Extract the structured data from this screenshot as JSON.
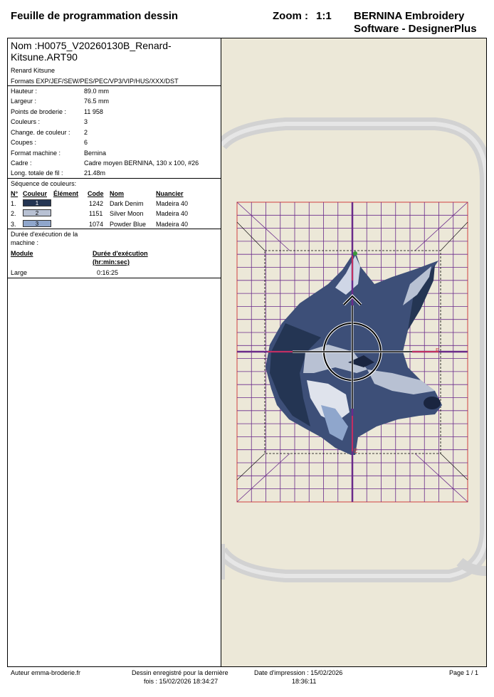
{
  "header": {
    "title": "Feuille de programmation dessin",
    "zoom_label": "Zoom :",
    "zoom_value": "1:1",
    "brand_line1": "BERNINA Embroidery",
    "brand_line2": "Software - DesignerPlus"
  },
  "design": {
    "name_line1": "Nom :H0075_V20260130B_Renard-",
    "name_line2": "Kitsune.ART90",
    "description": "Renard Kitsune",
    "formats": "Formats EXP/JEF/SEW/PES/PEC/VP3/VIP/HUS/XXX/DST"
  },
  "specs": [
    {
      "label": "Hauteur :",
      "value": "89.0 mm"
    },
    {
      "label": "Largeur :",
      "value": "76.5 mm"
    },
    {
      "label": "Points de broderie :",
      "value": "11 958"
    },
    {
      "label": "Couleurs :",
      "value": "3"
    },
    {
      "label": "Change. de couleur :",
      "value": "2"
    },
    {
      "label": "Coupes :",
      "value": "6"
    },
    {
      "label": "Format machine :",
      "value": "Bernina"
    },
    {
      "label": "Cadre :",
      "value": "Cadre moyen BERNINA, 130 x 100, #26"
    },
    {
      "label": "Long. totale de fil :",
      "value": "21.48m"
    }
  ],
  "colors": {
    "section_title": "Séquence de couleurs:",
    "headers": {
      "num": "N°",
      "color": "Couleur",
      "element": "Élément",
      "code": "Code",
      "name": "Nom",
      "chart": "Nuancier"
    },
    "rows": [
      {
        "num": "1.",
        "swatch_label": "1",
        "swatch_color": "#243553",
        "text_color": "#ffffff",
        "code": "1242",
        "name": "Dark Denim",
        "chart": "Madeira 40"
      },
      {
        "num": "2.",
        "swatch_label": "2",
        "swatch_color": "#b8c1d3",
        "text_color": "#000000",
        "code": "1151",
        "name": "Silver Moon",
        "chart": "Madeira 40"
      },
      {
        "num": "3.",
        "swatch_label": "3",
        "swatch_color": "#8fa6cc",
        "text_color": "#000000",
        "code": "1074",
        "name": "Powder Blue",
        "chart": "Madeira 40"
      }
    ]
  },
  "runtime": {
    "title_line1": "Durée d'exécution de la",
    "title_line2": "machine :",
    "col_module": "Module",
    "col_duration_line1": "Durée d'exécution",
    "col_duration_line2": "(hr:min:sec)",
    "module": "Large",
    "duration": "0:16:25"
  },
  "footer": {
    "author": "Auteur emma-broderie.fr",
    "saved_line1": "Dessin enregistré pour la dernière",
    "saved_line2": "fois : 15/02/2026 18:34:27",
    "printed_line1": "Date d'impression : 15/02/2026",
    "printed_line2": "18:36:11",
    "page": "Page 1 / 1"
  },
  "colors_theme": {
    "hoop_bg": "#ece8d8",
    "hoop_frame": "#cfcfcf",
    "grid_red": "#d04040",
    "grid_purple": "#6a2a8a",
    "fox_dark": "#243553",
    "fox_mid": "#4b5f8c",
    "fox_light": "#b8c1d3",
    "fox_pale": "#dfe3ec"
  },
  "marks": {
    "grid_letter": "E"
  }
}
